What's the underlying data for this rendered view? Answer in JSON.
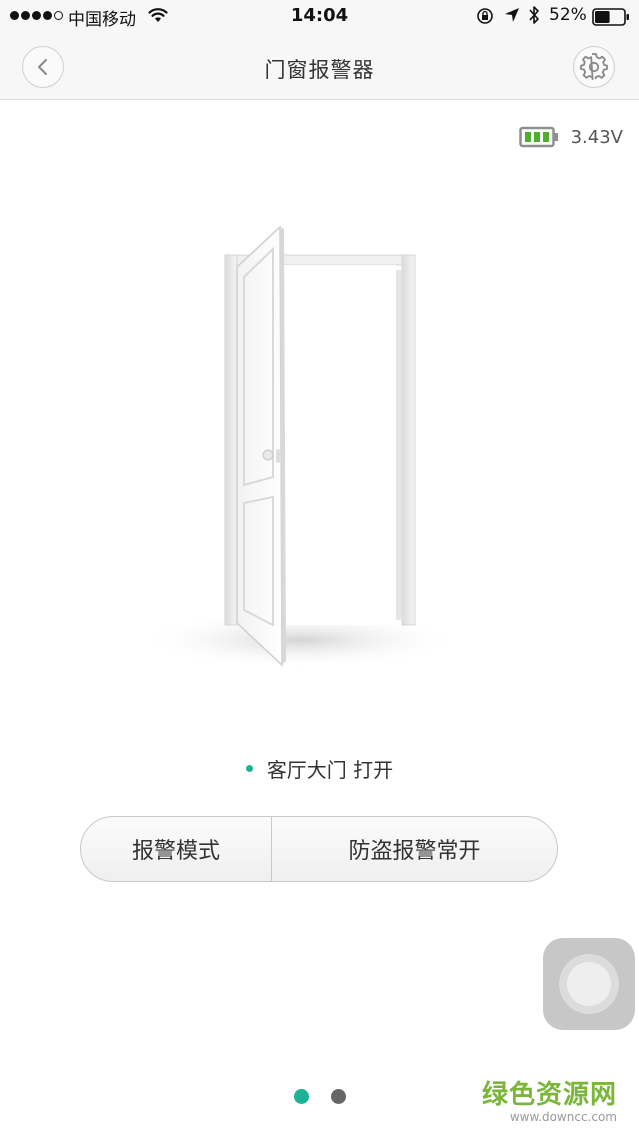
{
  "status_bar": {
    "carrier": "中国移动",
    "time": "14:04",
    "battery_percent": "52%",
    "battery_level": 0.52,
    "signal_strength": 4,
    "icons": [
      "wifi-icon",
      "rotation-lock-icon",
      "location-arrow-icon",
      "bluetooth-icon",
      "battery-icon"
    ]
  },
  "nav": {
    "title": "门窗报警器",
    "back_icon": "chevron-left-icon",
    "settings_icon": "gear-icon"
  },
  "device": {
    "battery_voltage": "3.43V",
    "battery_icon": "battery-full-icon",
    "battery_color": "#4caf2a"
  },
  "door_status": {
    "text": "客厅大门 打开",
    "dot_color": "#1bb394",
    "illustration": "open-door-icon"
  },
  "mode": {
    "label": "报警模式",
    "value": "防盗报警常开"
  },
  "pager": {
    "count": 2,
    "active": 0,
    "active_color": "#1bb394"
  },
  "watermark": {
    "main": "绿色资源网",
    "sub": "www.downcc.com"
  }
}
